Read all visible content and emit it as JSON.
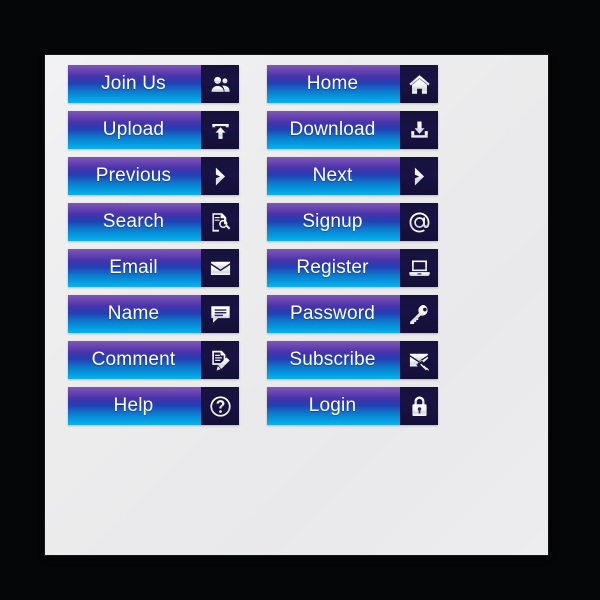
{
  "panel": {
    "background_color": "#050607",
    "card_color": "#ececee"
  },
  "theme": {
    "gradient_top": "#7143ae",
    "gradient_mid": "#2140b4",
    "gradient_bottom": "#12b0e8",
    "icon_box_color": "#191243",
    "label_color": "#ffffff"
  },
  "buttons": {
    "left_column": [
      {
        "label": "Join Us",
        "icon": "users-icon"
      },
      {
        "label": "Upload",
        "icon": "upload-icon"
      },
      {
        "label": "Previous",
        "icon": "chevron-right-icon"
      },
      {
        "label": "Search",
        "icon": "document-search-icon"
      },
      {
        "label": "Email",
        "icon": "envelope-icon"
      },
      {
        "label": "Name",
        "icon": "speech-bubble-icon"
      },
      {
        "label": "Comment",
        "icon": "document-pencil-icon"
      },
      {
        "label": "Help",
        "icon": "question-circle-icon"
      }
    ],
    "right_column": [
      {
        "label": "Home",
        "icon": "house-icon"
      },
      {
        "label": "Download",
        "icon": "download-icon"
      },
      {
        "label": "Next",
        "icon": "chevron-right-icon"
      },
      {
        "label": "Signup",
        "icon": "at-sign-icon"
      },
      {
        "label": "Register",
        "icon": "laptop-icon"
      },
      {
        "label": "Password",
        "icon": "key-icon"
      },
      {
        "label": "Subscribe",
        "icon": "envelope-plug-icon"
      },
      {
        "label": "Login",
        "icon": "padlock-icon"
      }
    ]
  }
}
